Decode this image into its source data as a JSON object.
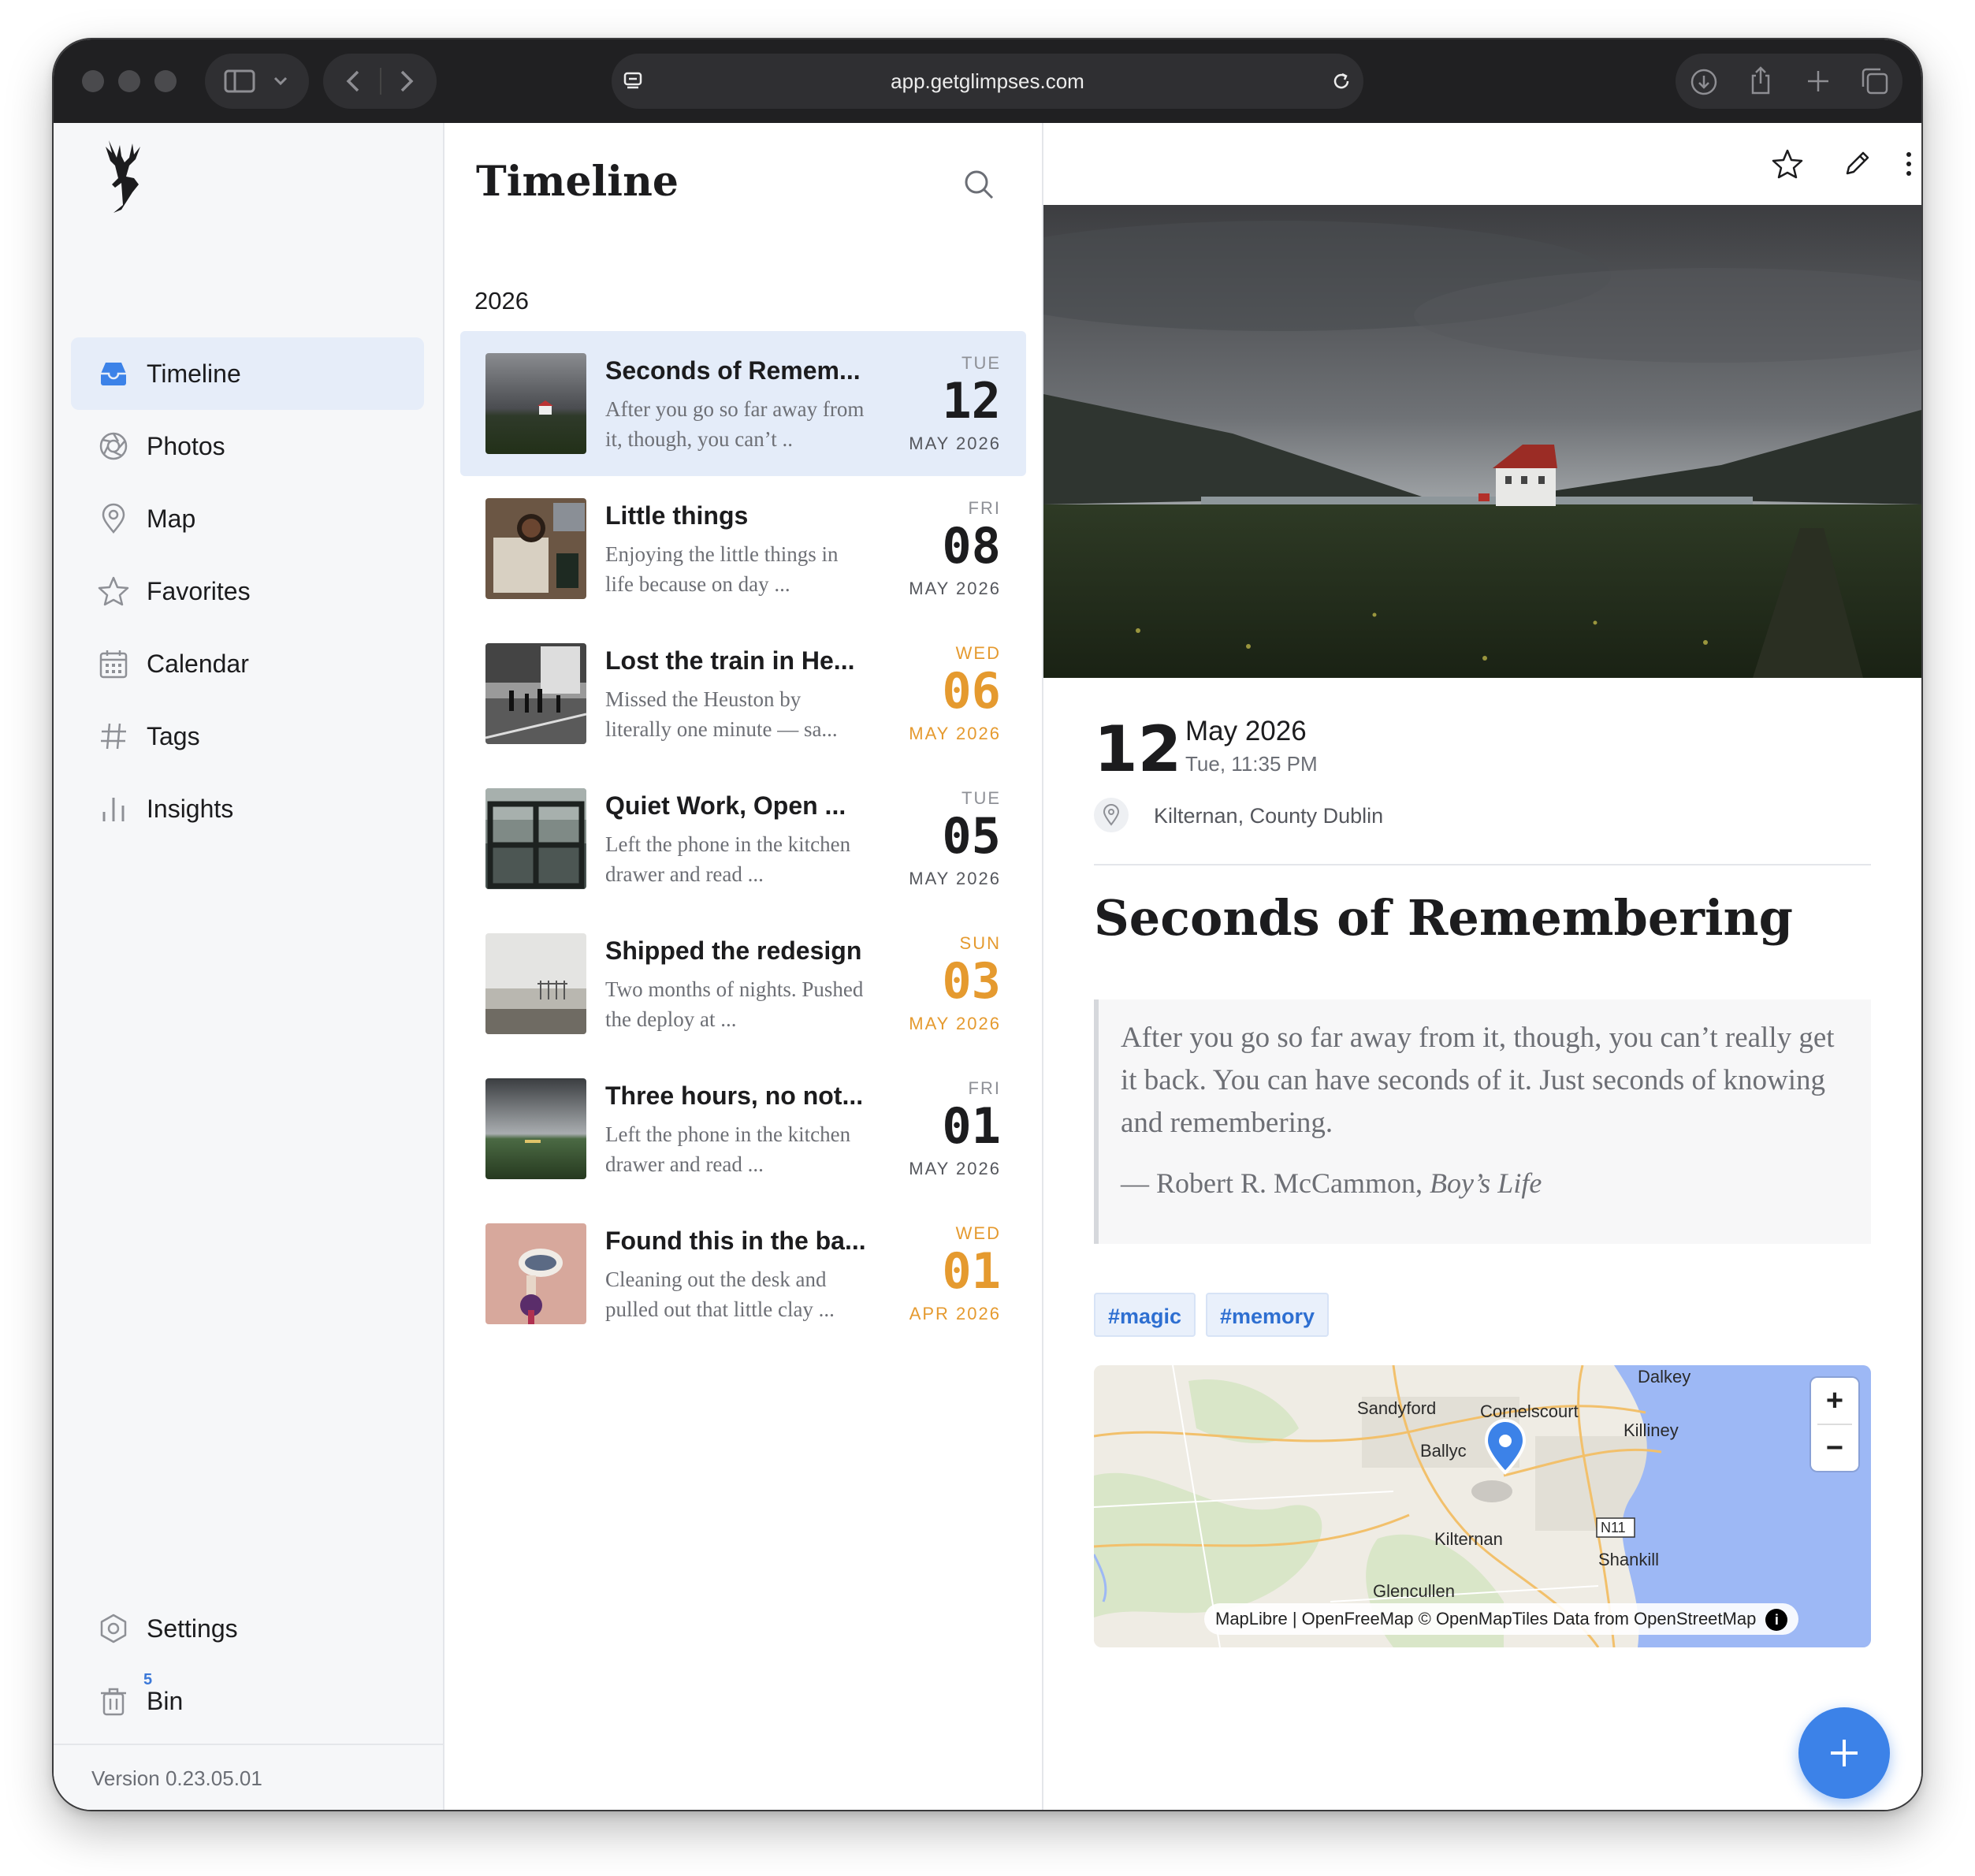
{
  "browser": {
    "url": "app.getglimpses.com"
  },
  "sidebar": {
    "items": [
      {
        "label": "Timeline",
        "icon": "inbox-icon"
      },
      {
        "label": "Photos",
        "icon": "aperture-icon"
      },
      {
        "label": "Map",
        "icon": "map-pin-icon"
      },
      {
        "label": "Favorites",
        "icon": "star-icon"
      },
      {
        "label": "Calendar",
        "icon": "calendar-icon"
      },
      {
        "label": "Tags",
        "icon": "hash-icon"
      },
      {
        "label": "Insights",
        "icon": "bar-chart-icon"
      }
    ],
    "settings_label": "Settings",
    "bin_label": "Bin",
    "bin_count": "5",
    "version": "Version 0.23.05.01"
  },
  "timeline": {
    "title": "Timeline",
    "year": "2026",
    "entries": [
      {
        "title": "Seconds of Remem...",
        "excerpt": "After you go so far away from it, though, you can’t ..",
        "dow": "TUE",
        "day": "12",
        "month": "MAY 2026"
      },
      {
        "title": "Little things",
        "excerpt": "Enjoying the little things in life because on day ...",
        "dow": "FRI",
        "day": "08",
        "month": "MAY 2026"
      },
      {
        "title": "Lost the train in He...",
        "excerpt": "Missed the Heuston by literally one minute — sa...",
        "dow": "WED",
        "day": "06",
        "month": "MAY 2026"
      },
      {
        "title": "Quiet Work, Open ...",
        "excerpt": "Left the phone in the kitchen drawer and read ...",
        "dow": "TUE",
        "day": "05",
        "month": "MAY 2026"
      },
      {
        "title": "Shipped the redesign",
        "excerpt": "Two months of nights. Pushed the deploy at ...",
        "dow": "SUN",
        "day": "03",
        "month": "MAY 2026"
      },
      {
        "title": "Three hours, no not...",
        "excerpt": "Left the phone in the kitchen drawer and read ...",
        "dow": "FRI",
        "day": "01",
        "month": "MAY 2026"
      },
      {
        "title": "Found this in the ba...",
        "excerpt": "Cleaning out the desk and pulled out that little clay ...",
        "dow": "WED",
        "day": "01",
        "month": "APR 2026"
      }
    ]
  },
  "detail": {
    "day": "12",
    "month_year": "May 2026",
    "weekday_time": "Tue, 11:35 PM",
    "location": "Kilternan, County Dublin",
    "title": "Seconds of Remembering",
    "quote": "After you go so far away from it, though, you can’t really get it back. You can have seconds of it. Just seconds of knowing and remembering.",
    "quote_author": "— Robert R. McCammon, ",
    "quote_source": "Boy’s Life",
    "tags": [
      "#magic",
      "#memory"
    ],
    "map": {
      "labels": [
        "Dalkey",
        "Sandyford",
        "Cornelscourt",
        "Killiney",
        "Ballyc",
        "Kilternan",
        "N11",
        "Shankill",
        "Glencullen"
      ],
      "attribution_1": "MapLibre | OpenFreeMap © OpenMapTiles ",
      "attribution_2": "Data from ",
      "attribution_3": "OpenStreetMap",
      "info": "i",
      "zoom_in": "+",
      "zoom_out": "−"
    }
  },
  "colors": {
    "accent": "#3c82e8",
    "weekend": "#e59a2f",
    "active_row": "#e4ecf9",
    "sidebar_bg": "#f6f7f9",
    "titlebar_bg": "#202022"
  }
}
